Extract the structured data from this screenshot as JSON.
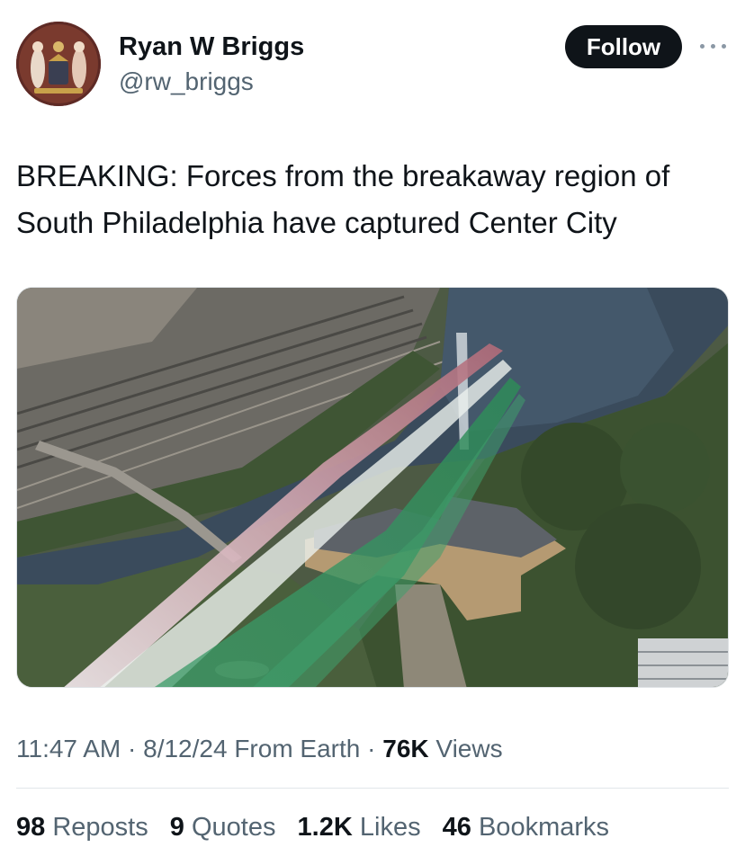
{
  "author": {
    "display_name": "Ryan W Briggs",
    "handle": "@rw_briggs",
    "avatar_icon": "philadelphia-seal-avatar"
  },
  "actions": {
    "follow_label": "Follow",
    "more_icon": "more-dots-icon"
  },
  "tweet": {
    "text": "BREAKING: Forces from the breakaway region of South Philadelphia have captured Center City"
  },
  "media": {
    "description_icon": "aerial-photo"
  },
  "meta": {
    "time": "11:47 AM",
    "date": "8/12/24",
    "source": "From Earth",
    "views_count": "76K",
    "views_label": "Views"
  },
  "stats": [
    {
      "count": "98",
      "label": "Reposts"
    },
    {
      "count": "9",
      "label": "Quotes"
    },
    {
      "count": "1.2K",
      "label": "Likes"
    },
    {
      "count": "46",
      "label": "Bookmarks"
    }
  ],
  "colors": {
    "text_primary": "#0f1419",
    "text_secondary": "#536471",
    "follow_bg": "#0f1419",
    "divider": "#e1e6ea"
  }
}
